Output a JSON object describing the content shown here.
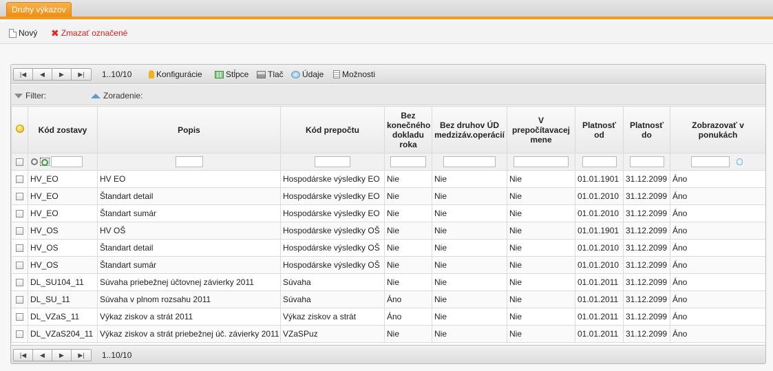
{
  "tab": {
    "label": "Druhy výkazov"
  },
  "toolbar": {
    "new_label": "Nový",
    "delete_label": "Zmazať označené"
  },
  "pager": {
    "info": "1..10/10",
    "first": "|◀",
    "prev": "◀",
    "next": "▶",
    "last": "▶|",
    "tools": {
      "config": "Konfigurácie",
      "columns": "Stĺpce",
      "print": "Tlač",
      "data": "Údaje",
      "options": "Možnosti"
    }
  },
  "filterbar": {
    "filter": "Filter:",
    "sort": "Zoradenie:"
  },
  "columns": [
    "Kód zostavy",
    "Popis",
    "Kód prepočtu",
    "Bez konečného dokladu roka",
    "Bez druhov ÚD medzizáv.operácií",
    "V prepočítavacej mene",
    "Platnosť od",
    "Platnosť do",
    "Zobrazovať v ponukách"
  ],
  "rows": [
    [
      "HV_EO",
      "HV EO",
      "Hospodárske výsledky EO",
      "Nie",
      "Nie",
      "Nie",
      "01.01.1901",
      "31.12.2099",
      "Áno"
    ],
    [
      "HV_EO",
      "Štandart detail",
      "Hospodárske výsledky EO",
      "Nie",
      "Nie",
      "Nie",
      "01.01.2010",
      "31.12.2099",
      "Áno"
    ],
    [
      "HV_EO",
      "Štandart sumár",
      "Hospodárske výsledky EO",
      "Nie",
      "Nie",
      "Nie",
      "01.01.2010",
      "31.12.2099",
      "Áno"
    ],
    [
      "HV_OS",
      "HV OŠ",
      "Hospodárske výsledky OŠ",
      "Nie",
      "Nie",
      "Nie",
      "01.01.1901",
      "31.12.2099",
      "Áno"
    ],
    [
      "HV_OS",
      "Štandart detail",
      "Hospodárske výsledky OŠ",
      "Nie",
      "Nie",
      "Nie",
      "01.01.2010",
      "31.12.2099",
      "Áno"
    ],
    [
      "HV_OS",
      "Štandart sumár",
      "Hospodárske výsledky OŠ",
      "Nie",
      "Nie",
      "Nie",
      "01.01.2010",
      "31.12.2099",
      "Áno"
    ],
    [
      "DL_SU104_11",
      "Súvaha priebežnej účtovnej závierky 2011",
      "Súvaha",
      "Nie",
      "Nie",
      "Nie",
      "01.01.2011",
      "31.12.2099",
      "Áno"
    ],
    [
      "DL_SU_11",
      "Súvaha v plnom rozsahu 2011",
      "Súvaha",
      "Áno",
      "Nie",
      "Nie",
      "01.01.2011",
      "31.12.2099",
      "Áno"
    ],
    [
      "DL_VZaS_11",
      "Výkaz ziskov a strát 2011",
      "Výkaz ziskov a strát",
      "Áno",
      "Nie",
      "Nie",
      "01.01.2011",
      "31.12.2099",
      "Áno"
    ],
    [
      "DL_VZaS204_11",
      "Výkaz ziskov a strát priebežnej úč. závierky 2011",
      "VZaSPuz",
      "Nie",
      "Nie",
      "Nie",
      "01.01.2011",
      "31.12.2099",
      "Áno"
    ]
  ]
}
